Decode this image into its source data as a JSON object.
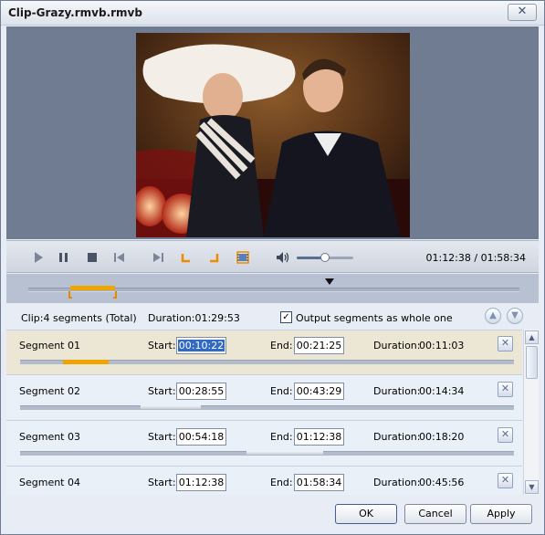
{
  "window": {
    "title": "Clip-Grazy.rmvb.rmvb",
    "close_label": "✕"
  },
  "player": {
    "time_current": "01:12:38",
    "time_total": "01:58:34",
    "time_separator": " / ",
    "volume_level": 0.5,
    "controls": [
      "play-icon",
      "pause-icon",
      "stop-icon",
      "previous-icon",
      "next-icon",
      "mark-start-icon",
      "mark-end-icon",
      "snapshot-icon",
      "volume-icon"
    ]
  },
  "timeline": {
    "playhead_fraction": 0.613,
    "selected_segment_start": 0.086,
    "selected_segment_end": 0.177
  },
  "segments_header": {
    "count_text": "Clip:4 segments (Total)",
    "duration_text": "Duration:01:29:53",
    "checkbox_label": "Output segments as whole one",
    "checkbox_checked": true,
    "checkbox_mark": "✓",
    "move_up": "▲",
    "move_down": "▼"
  },
  "segment_labels": {
    "start": "Start:",
    "end": "End:",
    "duration": "Duration:",
    "delete": "✕"
  },
  "segments": [
    {
      "name": "Segment 01",
      "start": "00:10:22",
      "end": "00:21:25",
      "duration": "00:11:03",
      "selected": true
    },
    {
      "name": "Segment 02",
      "start": "00:28:55",
      "end": "00:43:29",
      "duration": "00:14:34",
      "selected": false
    },
    {
      "name": "Segment 03",
      "start": "00:54:18",
      "end": "01:12:38",
      "duration": "00:18:20",
      "selected": false
    },
    {
      "name": "Segment 04",
      "start": "01:12:38",
      "end": "01:58:34",
      "duration": "00:45:56",
      "selected": false
    }
  ],
  "scrollbar": {
    "up": "▲",
    "down": "▼"
  },
  "buttons": {
    "ok": "OK",
    "cancel": "Cancel",
    "apply": "Apply"
  },
  "colors": {
    "accent": "#f0a400",
    "selection": "#316ac5",
    "selected_row": "#ece6d4"
  }
}
